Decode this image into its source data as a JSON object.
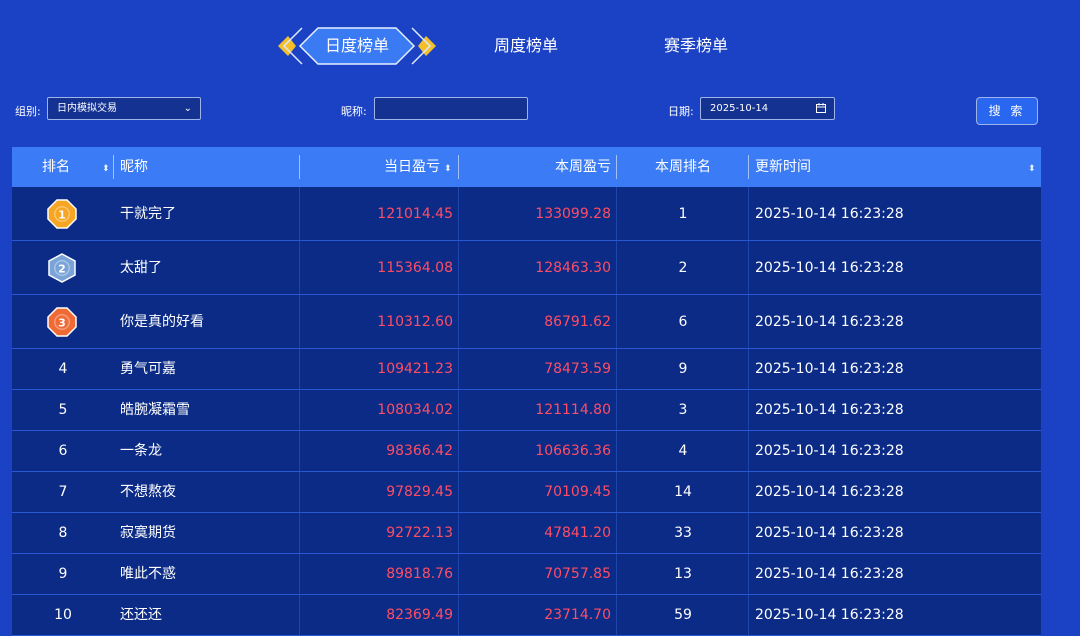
{
  "tabs": [
    {
      "label": "日度榜单",
      "active": true
    },
    {
      "label": "周度榜单",
      "active": false
    },
    {
      "label": "赛季榜单",
      "active": false
    }
  ],
  "filters": {
    "group_label": "组别:",
    "group_value": "日内模拟交易",
    "nickname_label": "昵称:",
    "nickname_value": "",
    "date_label": "日期:",
    "date_value": "2025-10-14",
    "search_label": "搜 索"
  },
  "columns": [
    "排名",
    "昵称",
    "当日盈亏",
    "本周盈亏",
    "本周排名",
    "更新时间"
  ],
  "rows": [
    {
      "rank": "1",
      "name": "干就完了",
      "daily": "121014.45",
      "weekly": "133099.28",
      "week_rank": "1",
      "time": "2025-10-14 16:23:28"
    },
    {
      "rank": "2",
      "name": "太甜了",
      "daily": "115364.08",
      "weekly": "128463.30",
      "week_rank": "2",
      "time": "2025-10-14 16:23:28"
    },
    {
      "rank": "3",
      "name": "你是真的好看",
      "daily": "110312.60",
      "weekly": "86791.62",
      "week_rank": "6",
      "time": "2025-10-14 16:23:28"
    },
    {
      "rank": "4",
      "name": "勇气可嘉",
      "daily": "109421.23",
      "weekly": "78473.59",
      "week_rank": "9",
      "time": "2025-10-14 16:23:28"
    },
    {
      "rank": "5",
      "name": "皓腕凝霜雪",
      "daily": "108034.02",
      "weekly": "121114.80",
      "week_rank": "3",
      "time": "2025-10-14 16:23:28"
    },
    {
      "rank": "6",
      "name": "一条龙",
      "daily": "98366.42",
      "weekly": "106636.36",
      "week_rank": "4",
      "time": "2025-10-14 16:23:28"
    },
    {
      "rank": "7",
      "name": "不想熬夜",
      "daily": "97829.45",
      "weekly": "70109.45",
      "week_rank": "14",
      "time": "2025-10-14 16:23:28"
    },
    {
      "rank": "8",
      "name": "寂寞期货",
      "daily": "92722.13",
      "weekly": "47841.20",
      "week_rank": "33",
      "time": "2025-10-14 16:23:28"
    },
    {
      "rank": "9",
      "name": "唯此不惑",
      "daily": "89818.76",
      "weekly": "70757.85",
      "week_rank": "13",
      "time": "2025-10-14 16:23:28"
    },
    {
      "rank": "10",
      "name": "还还还",
      "daily": "82369.49",
      "weekly": "23714.70",
      "week_rank": "59",
      "time": "2025-10-14 16:23:28"
    }
  ],
  "colors": {
    "background": "#1b42c4",
    "header": "#3b7cf6",
    "row": "#0b2b86",
    "profit": "#ff4d64",
    "gold": "#f6a623",
    "silver": "#7aa3d8",
    "bronze": "#f06a35"
  }
}
